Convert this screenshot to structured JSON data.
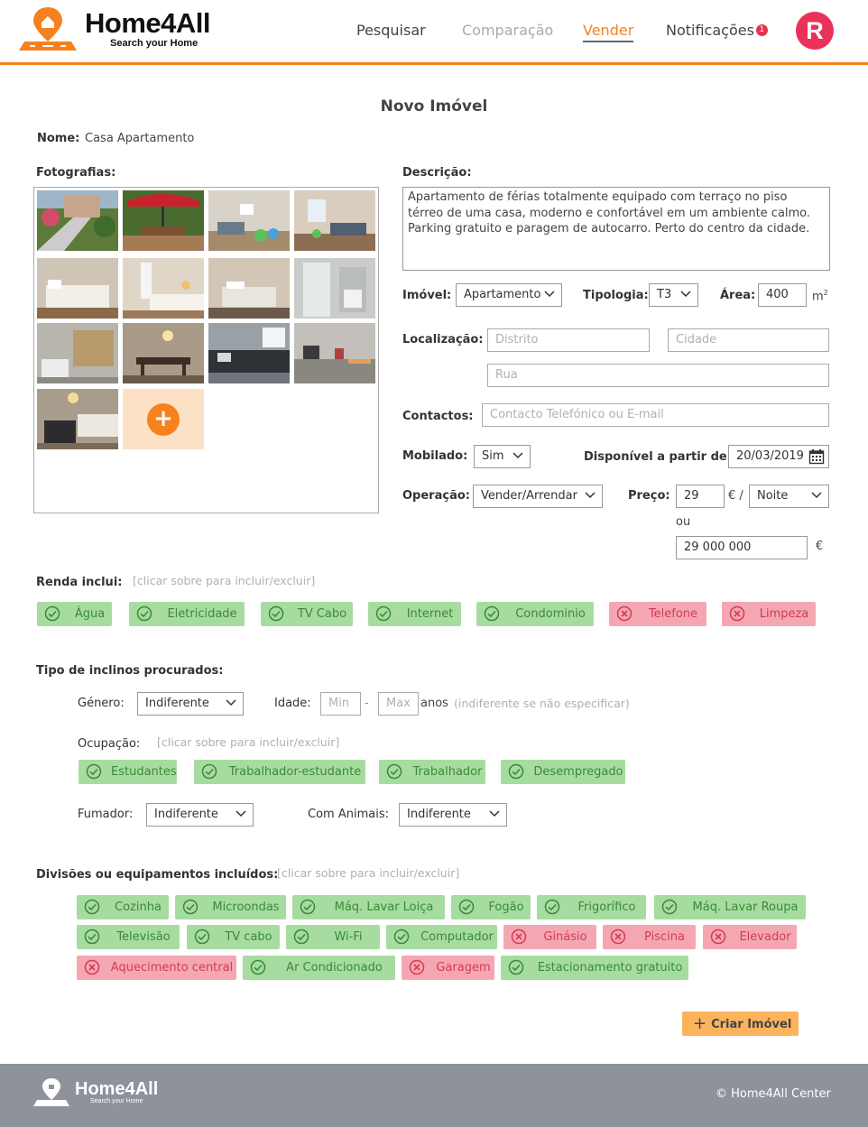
{
  "header": {
    "logo_title": "Home4All",
    "logo_subtitle": "Search your Home",
    "nav": {
      "search": "Pesquisar",
      "compare": "Comparação",
      "sell": "Vender",
      "notifications": "Notificações",
      "notifications_count": "1"
    },
    "avatar_letter": "R"
  },
  "form": {
    "title": "Novo Imóvel",
    "name_label": "Nome:",
    "name_value": "Casa Apartamento",
    "photos_label": "Fotografias:",
    "description_label": "Descrição:",
    "description": "Apartamento de férias totalmente equipado com terraço no piso térreo de uma casa, moderno e confortável em um ambiente calmo. Parking gratuito e paragem de autocarro. Perto do centro da cidade.",
    "property_label": "Imóvel:",
    "property_value": "Apartamento",
    "typology_label": "Tipologia:",
    "typology_value": "T3",
    "area_label": "Área:",
    "area_value": "400",
    "area_unit": "m",
    "area_unit_sup": "2",
    "location_label": "Localização:",
    "district_placeholder": "Distrito",
    "city_placeholder": "Cidade",
    "street_placeholder": "Rua",
    "contacts_label": "Contactos:",
    "contacts_placeholder": "Contacto Telefónico ou E-mail",
    "furnished_label": "Mobilado:",
    "furnished_value": "Sim",
    "available_label": "Disponível a partir de:",
    "available_value": "20/03/2019",
    "operation_label": "Operação:",
    "operation_value": "Vender/Arrendar",
    "price_label": "Preço:",
    "price_value": "29",
    "price_unit": "€ /",
    "period_value": "Noite",
    "or_label": "ou",
    "sale_price_value": "29 000 000",
    "sale_price_unit": "€"
  },
  "rent": {
    "label": "Renda inclui:",
    "hint": "[clicar sobre para incluir/excluir]",
    "tags": [
      {
        "label": "Água",
        "on": true
      },
      {
        "label": "Eletricidade",
        "on": true
      },
      {
        "label": "TV Cabo",
        "on": true
      },
      {
        "label": "Internet",
        "on": true
      },
      {
        "label": "Condominio",
        "on": true
      },
      {
        "label": "Telefone",
        "on": false
      },
      {
        "label": "Limpeza",
        "on": false
      }
    ]
  },
  "tenants": {
    "label": "Tipo de inclinos procurados:",
    "gender_label": "Género:",
    "gender_value": "Indiferente",
    "age_label": "Idade:",
    "age_min_placeholder": "Min",
    "age_dash": "-",
    "age_max_placeholder": "Max",
    "age_unit": "anos",
    "age_hint": "(indiferente se não especificar)",
    "occupation_label": "Ocupação:",
    "occupation_hint": "[clicar sobre para incluir/excluir]",
    "occupation_tags": [
      {
        "label": "Estudantes",
        "on": true
      },
      {
        "label": "Trabalhador-estudante",
        "on": true
      },
      {
        "label": "Trabalhador",
        "on": true
      },
      {
        "label": "Desempregado",
        "on": true
      }
    ],
    "smoker_label": "Fumador:",
    "smoker_value": "Indiferente",
    "pets_label": "Com Animais:",
    "pets_value": "Indiferente"
  },
  "rooms": {
    "label": "Divisões ou equipamentos incluídos:",
    "hint": "[clicar sobre para incluir/excluir]",
    "tags": [
      {
        "label": "Cozinha",
        "on": true
      },
      {
        "label": "Microondas",
        "on": true
      },
      {
        "label": "Máq. Lavar Loiça",
        "on": true
      },
      {
        "label": "Fogão",
        "on": true
      },
      {
        "label": "Frigorífico",
        "on": true
      },
      {
        "label": "Máq. Lavar Roupa",
        "on": true
      },
      {
        "label": "Televisão",
        "on": true
      },
      {
        "label": "TV cabo",
        "on": true
      },
      {
        "label": "Wi-Fi",
        "on": true
      },
      {
        "label": "Computador",
        "on": true
      },
      {
        "label": "Ginásio",
        "on": false
      },
      {
        "label": "Piscina",
        "on": false
      },
      {
        "label": "Elevador",
        "on": false
      },
      {
        "label": "Aquecimento central",
        "on": false
      },
      {
        "label": "Ar Condicionado",
        "on": true
      },
      {
        "label": "Garagem",
        "on": false
      },
      {
        "label": "Estacionamento gratuito",
        "on": true
      }
    ]
  },
  "actions": {
    "create_label": "Criar Imóvel"
  },
  "footer": {
    "logo_title": "Home4All",
    "logo_subtitle": "Search your Home",
    "copyright": "© Home4All Center"
  },
  "colors": {
    "accent": "#f5821f",
    "tag_on_bg": "#a7dca1",
    "tag_off_bg": "#f4a7b2",
    "avatar": "#e8325a"
  }
}
